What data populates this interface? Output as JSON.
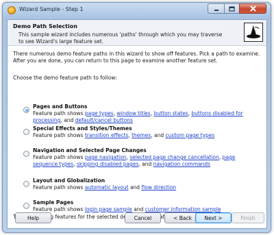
{
  "window": {
    "title": "Wizard Sample - Step 1",
    "icon": "app-icon"
  },
  "banner": {
    "title": "Demo Path Selection",
    "description": "This sample wizard includes numerous 'paths' through which you may traverse to see Wizard's large feature set.",
    "logo": "wizard-hat-icon"
  },
  "intro": "There numerous demo feature paths in this wizard to show off features. Pick a path to examine. After you are done, you can return to this page to examine another feature set.",
  "choose_label": "Choose the demo feature path to follow:",
  "options": [
    {
      "title": "Pages and Buttons",
      "checked": true,
      "prefix": "Feature path shows ",
      "links": [
        "page types",
        "window titles",
        "button states",
        "buttons disabled for processing",
        "default/cancel buttons"
      ],
      "conj": "and"
    },
    {
      "title": "Special Effects and Styles/Themes",
      "checked": false,
      "prefix": "Feature path shows ",
      "links": [
        "transition effects",
        "themes",
        "custom page types"
      ],
      "conj": "and"
    },
    {
      "title": "Navigation and Selected Page Changes",
      "checked": false,
      "prefix": "Feature path shows ",
      "links": [
        "page navigation",
        "selected page change cancellation",
        "page sequence types",
        "skipping disabled pages",
        "navigation commands"
      ],
      "conj": "and"
    },
    {
      "title": "Layout and Globalization",
      "checked": false,
      "prefix": "Feature path shows ",
      "links": [
        "automatic layout",
        "flow direction"
      ],
      "conj": "and"
    },
    {
      "title": "Sample Pages",
      "checked": false,
      "prefix": "Feature path shows ",
      "links": [
        "login page sample",
        "customer information sample"
      ],
      "conj": "and"
    }
  ],
  "footer": "To start viewing features for the selected demo feature path, click Next.",
  "buttons": {
    "help": "Help",
    "cancel": "Cancel",
    "back": "< Back",
    "next": "Next >",
    "finish": "Finish"
  },
  "colors": {
    "link": "#1a3fc9",
    "close_button": "#c7452d",
    "accent": "#3a8dd8"
  }
}
